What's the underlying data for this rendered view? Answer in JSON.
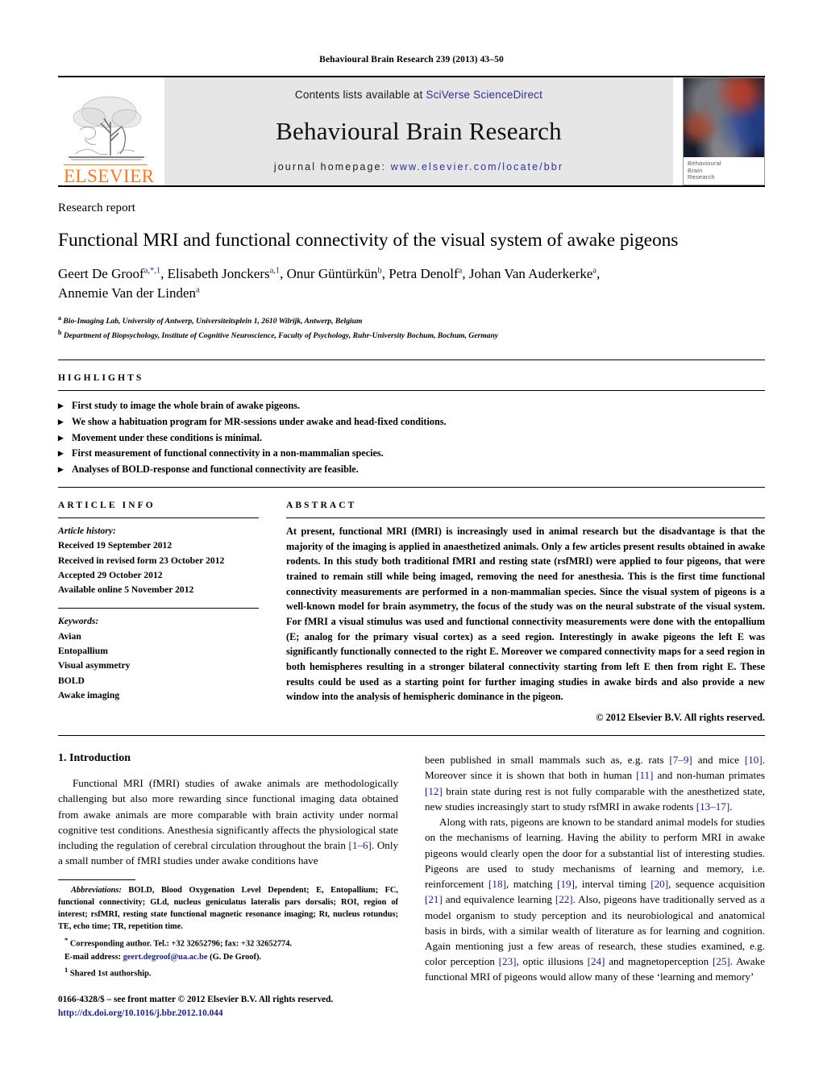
{
  "running_head": "Behavioural Brain Research 239 (2013) 43–50",
  "masthead": {
    "publisher_name": "ELSEVIER",
    "contents_prefix": "Contents lists available at ",
    "contents_link": "SciVerse ScienceDirect",
    "journal_title": "Behavioural Brain Research",
    "homepage_prefix": "journal homepage: ",
    "homepage_url": "www.elsevier.com/locate/bbr",
    "cover_caption_line1": "Behavioural",
    "cover_caption_line2": "Brain",
    "cover_caption_line3": "Research",
    "link_color": "#2f2f9e",
    "brand_color": "#F47920"
  },
  "article": {
    "doctype": "Research report",
    "title": "Functional MRI and functional connectivity of the visual system of awake pigeons",
    "authors_line1_a": "Geert De Groof",
    "authors_line1_a_sup": "a,*,1",
    "authors_line1_b": ", Elisabeth Jonckers",
    "authors_line1_b_sup": "a,1",
    "authors_line1_c": ", Onur Güntürkün",
    "authors_line1_c_sup": "b",
    "authors_line1_d": ", Petra Denolf",
    "authors_line1_d_sup": "a",
    "authors_line1_e": ", Johan Van Auderkerke",
    "authors_line1_e_sup": "a",
    "authors_line1_f": ",",
    "authors_line2": "Annemie Van der Linden",
    "authors_line2_sup": "a",
    "affiliation_a_sup": "a",
    "affiliation_a": "Bio-Imaging Lab, University of Antwerp, Universiteitsplein 1, 2610 Wilrijk, Antwerp, Belgium",
    "affiliation_b_sup": "b",
    "affiliation_b": "Department of Biopsychology, Institute of Cognitive Neuroscience, Faculty of Psychology, Ruhr-University Bochum, Bochum, Germany"
  },
  "highlights": {
    "heading": "HIGHLIGHTS",
    "items": [
      "First study to image the whole brain of awake pigeons.",
      "We show a habituation program for MR-sessions under awake and head-fixed conditions.",
      "Movement under these conditions is minimal.",
      "First measurement of functional connectivity in a non-mammalian species.",
      "Analyses of BOLD-response and functional connectivity are feasible."
    ]
  },
  "article_info": {
    "heading": "ARTICLE INFO",
    "history_label": "Article history:",
    "history": [
      "Received 19 September 2012",
      "Received in revised form 23 October 2012",
      "Accepted 29 October 2012",
      "Available online 5 November 2012"
    ],
    "keywords_label": "Keywords:",
    "keywords": [
      "Avian",
      "Entopallium",
      "Visual asymmetry",
      "BOLD",
      "Awake imaging"
    ]
  },
  "abstract": {
    "heading": "ABSTRACT",
    "body": "At present, functional MRI (fMRI) is increasingly used in animal research but the disadvantage is that the majority of the imaging is applied in anaesthetized animals. Only a few articles present results obtained in awake rodents. In this study both traditional fMRI and resting state (rsfMRI) were applied to four pigeons, that were trained to remain still while being imaged, removing the need for anesthesia. This is the first time functional connectivity measurements are performed in a non-mammalian species. Since the visual system of pigeons is a well-known model for brain asymmetry, the focus of the study was on the neural substrate of the visual system. For fMRI a visual stimulus was used and functional connectivity measurements were done with the entopallium (E; analog for the primary visual cortex) as a seed region. Interestingly in awake pigeons the left E was significantly functionally connected to the right E. Moreover we compared connectivity maps for a seed region in both hemispheres resulting in a stronger bilateral connectivity starting from left E then from right E. These results could be used as a starting point for further imaging studies in awake birds and also provide a new window into the analysis of hemispheric dominance in the pigeon.",
    "copyright": "© 2012 Elsevier B.V. All rights reserved."
  },
  "introduction": {
    "heading": "1.  Introduction",
    "para1_part1": "Functional MRI (fMRI) studies of awake animals are methodologically challenging but also more rewarding since functional imaging data obtained from awake animals are more comparable with brain activity under normal cognitive test conditions. Anesthesia significantly affects the physiological state including the regulation of cerebral circulation throughout the brain ",
    "para1_ref1": "[1–6]",
    "para1_part2": ". Only a small number of fMRI studies under awake conditions have been published in small mammals such as, e.g. rats ",
    "para1_ref2": "[7–9]",
    "para1_part3": " and mice ",
    "para1_ref3": "[10]",
    "para1_part4": ". Moreover since it is shown that both in human ",
    "para1_ref4": "[11]",
    "para1_part5": " and non-human primates ",
    "para1_ref5": "[12]",
    "para1_part6": " brain state during rest is not fully comparable with the anesthetized state, new studies increasingly start to study rsfMRI in awake rodents ",
    "para1_ref6": "[13–17]",
    "para1_part7": ".",
    "para2_part1": "Along with rats, pigeons are known to be standard animal models for studies on the mechanisms of learning. Having the ability to perform MRI in awake pigeons would clearly open the door for a substantial list of interesting studies. Pigeons are used to study mechanisms of learning and memory, i.e. reinforcement ",
    "para2_ref1": "[18]",
    "para2_part2": ", matching ",
    "para2_ref2": "[19]",
    "para2_part3": ", interval timing ",
    "para2_ref3": "[20]",
    "para2_part4": ", sequence acquisition ",
    "para2_ref4": "[21]",
    "para2_part5": " and equivalence learning ",
    "para2_ref5": "[22]",
    "para2_part6": ". Also, pigeons have traditionally served as a model organism to study perception and its neurobiological and anatomical basis in birds, with a similar wealth of literature as for learning and cognition. Again mentioning just a few areas of research, these studies examined, e.g. color perception ",
    "para2_ref6": "[23]",
    "para2_part7": ", optic illusions ",
    "para2_ref7": "[24]",
    "para2_part8": " and magnetoperception ",
    "para2_ref8": "[25]",
    "para2_part9": ". Awake functional MRI of pigeons would allow many of these ‘learning and memory’"
  },
  "footnotes": {
    "abbrev_label": "Abbreviations:",
    "abbrev_text": " BOLD, Blood Oxygenation Level Dependent; E, Entopallium; FC, functional connectivity; GLd, nucleus geniculatus lateralis pars dorsalis; ROI, region of interest; rsfMRI, resting state functional magnetic resonance imaging; Rt, nucleus rotundus; TE, echo time; TR, repetition time.",
    "corresponding_marker": "*",
    "corresponding_text": " Corresponding author. Tel.: +32 32652796; fax: +32 32652774.",
    "email_label": "E-mail address:",
    "email": "geert.degroof@ua.ac.be",
    "email_suffix": " (G. De Groof).",
    "shared_marker": "1",
    "shared_text": " Shared 1st authorship.",
    "issn_line": "0166-4328/$ – see front matter © 2012 Elsevier B.V. All rights reserved.",
    "doi_line": "http://dx.doi.org/10.1016/j.bbr.2012.10.044"
  }
}
